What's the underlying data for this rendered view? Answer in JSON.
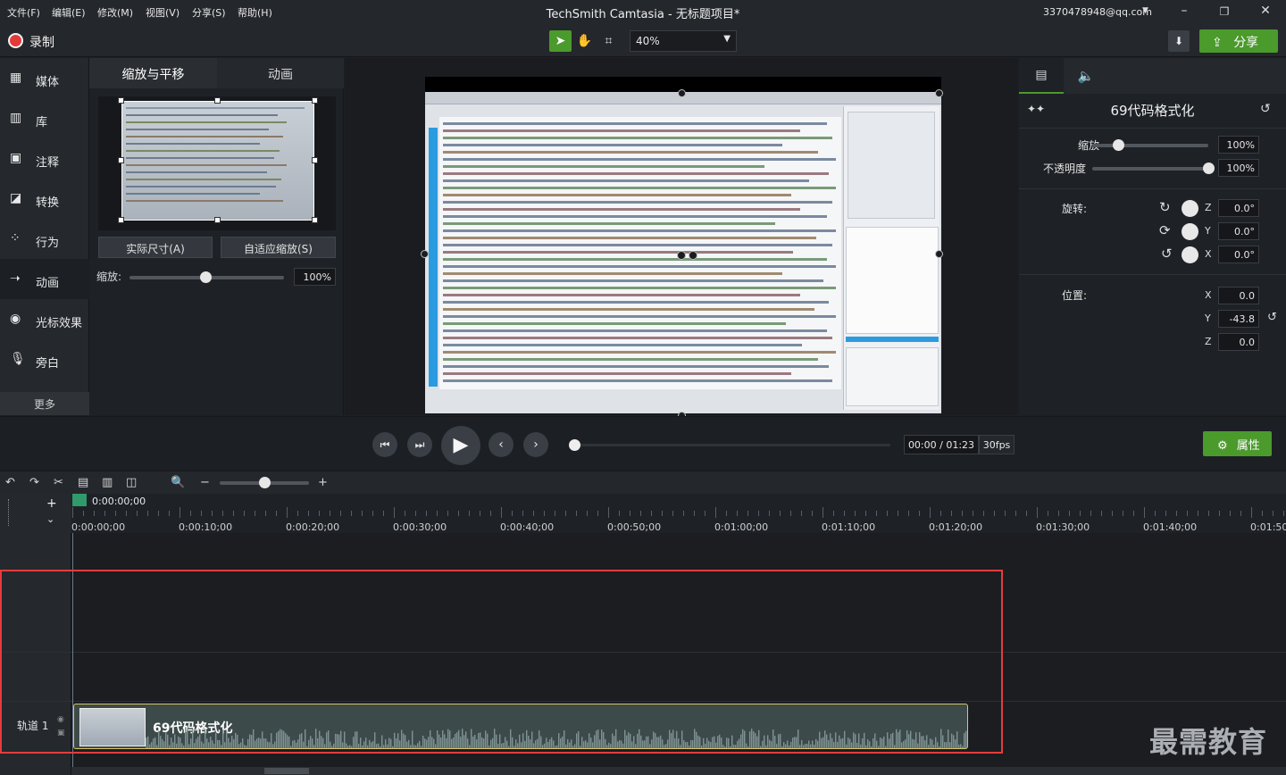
{
  "menu": [
    "文件(F)",
    "编辑(E)",
    "修改(M)",
    "视图(V)",
    "分享(S)",
    "帮助(H)"
  ],
  "window": {
    "title": "TechSmith Camtasia - 无标题项目*",
    "account": "3370478948@qq.com"
  },
  "toolbar": {
    "record": "录制",
    "zoom": "40%",
    "share": "分享"
  },
  "nav": [
    {
      "label": "媒体",
      "icon": "film-icon"
    },
    {
      "label": "库",
      "icon": "library-icon"
    },
    {
      "label": "注释",
      "icon": "annotation-icon"
    },
    {
      "label": "转换",
      "icon": "transition-icon"
    },
    {
      "label": "行为",
      "icon": "behavior-icon"
    },
    {
      "label": "动画",
      "icon": "animation-icon"
    },
    {
      "label": "光标效果",
      "icon": "cursor-icon"
    },
    {
      "label": "旁白",
      "icon": "microphone-icon"
    }
  ],
  "nav_more": "更多",
  "anim_panel": {
    "tabs": [
      "缩放与平移",
      "动画"
    ],
    "actual_size": "实际尺寸(A)",
    "fit_zoom": "自适应缩放(S)",
    "scale_label": "缩放:",
    "scale_value": "100%",
    "scale_level": 0.49
  },
  "properties": {
    "clip_title": "69代码格式化",
    "scale_label": "缩放",
    "scale_value": "100%",
    "scale_level": 0.22,
    "opacity_label": "不透明度",
    "opacity_value": "100%",
    "opacity_level": 1.0,
    "rotation_label": "旋转:",
    "rotation": {
      "z": "0.0°",
      "y": "0.0°",
      "x": "0.0°"
    },
    "position_label": "位置:",
    "position": {
      "x": "0.0",
      "y": "-43.8",
      "z": "0.0"
    },
    "axes": [
      "Z",
      "Y",
      "X",
      "X",
      "Y",
      "Z"
    ]
  },
  "playback": {
    "timecode": "00:00 / 01:23",
    "fps": "30fps",
    "properties_btn": "属性"
  },
  "timeline": {
    "playhead": "0:00:00;00",
    "ticks": [
      "0:00:00;00",
      "0:00:10;00",
      "0:00:20;00",
      "0:00:30;00",
      "0:00:40;00",
      "0:00:50;00",
      "0:01:00;00",
      "0:01:10;00",
      "0:01:20;00",
      "0:01:30;00",
      "0:01:40;00",
      "0:01:50;"
    ],
    "track_label": "轨道 1",
    "clip_name": "69代码格式化"
  },
  "watermark": "最需教育"
}
